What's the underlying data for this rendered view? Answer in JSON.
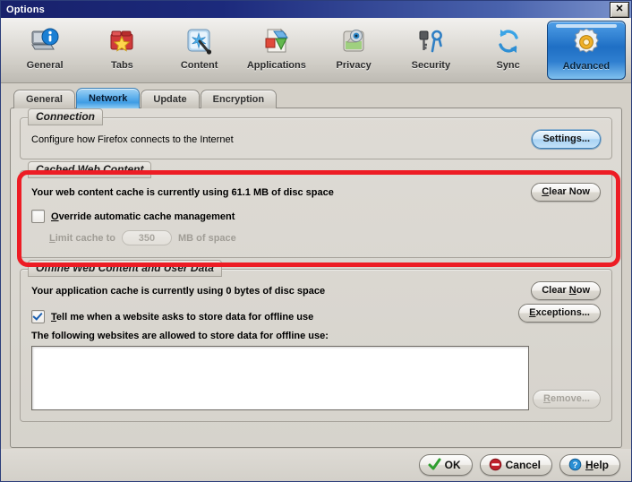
{
  "window": {
    "title": "Options",
    "close_label": "✕"
  },
  "toolbar": {
    "items": [
      {
        "label": "General",
        "icon": "computer-info-icon",
        "selected": false
      },
      {
        "label": "Tabs",
        "icon": "tabs-star-icon",
        "selected": false
      },
      {
        "label": "Content",
        "icon": "content-cursor-icon",
        "selected": false
      },
      {
        "label": "Applications",
        "icon": "applications-icon",
        "selected": false
      },
      {
        "label": "Privacy",
        "icon": "privacy-mask-icon",
        "selected": false
      },
      {
        "label": "Security",
        "icon": "security-key-icon",
        "selected": false
      },
      {
        "label": "Sync",
        "icon": "sync-arrows-icon",
        "selected": false
      },
      {
        "label": "Advanced",
        "icon": "advanced-gear-icon",
        "selected": true
      }
    ]
  },
  "tabs": [
    {
      "label": "General",
      "active": false
    },
    {
      "label": "Network",
      "active": true
    },
    {
      "label": "Update",
      "active": false
    },
    {
      "label": "Encryption",
      "active": false
    }
  ],
  "connection": {
    "group_title": "Connection",
    "description": "Configure how Firefox connects to the Internet",
    "settings_button": "Settings..."
  },
  "cached_web_content": {
    "group_title": "Cached Web Content",
    "usage_text": "Your web content cache is currently using 61.1 MB of disc space",
    "clear_button": "Clear Now",
    "override_label": "Override automatic cache management",
    "override_checked": false,
    "limit_prefix": "Limit cache to",
    "limit_value": "350",
    "limit_suffix": "MB of space",
    "limit_enabled": false
  },
  "offline_web_content": {
    "group_title": "Offline Web Content and User Data",
    "usage_text": "Your application cache is currently using 0 bytes of disc space",
    "clear_button": "Clear Now",
    "exceptions_button": "Exceptions...",
    "notify_label": "Tell me when a website asks to store data for offline use",
    "notify_checked": true,
    "list_caption": "The following websites are allowed to store data for offline use:",
    "list_items": [],
    "remove_button": "Remove...",
    "remove_enabled": false
  },
  "dialog_buttons": {
    "ok": "OK",
    "cancel": "Cancel",
    "help": "Help"
  },
  "annotation": {
    "shape": "rounded-rectangle",
    "color": "#ed1c24",
    "target": "Cached Web Content"
  },
  "colors": {
    "titlebar_start": "#18216b",
    "titlebar_end": "#7b93cc",
    "accent_blue": "#2f7fd0",
    "panel_bg": "#d6d3cc",
    "annotation_red": "#ed1c24"
  }
}
